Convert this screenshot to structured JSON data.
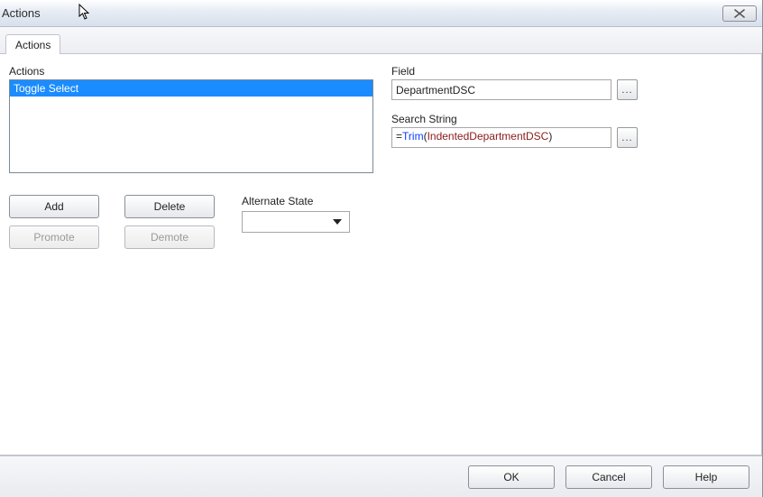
{
  "window": {
    "title": "Actions"
  },
  "tabs": [
    "Actions"
  ],
  "panel": {
    "actions_label": "Actions",
    "actions": [
      "Toggle Select"
    ],
    "add_label": "Add",
    "delete_label": "Delete",
    "promote_label": "Promote",
    "demote_label": "Demote",
    "alternate_state_label": "Alternate State",
    "alternate_state_value": "",
    "field_label": "Field",
    "field_value": "DepartmentDSC",
    "search_string_label": "Search String",
    "search_string_expr": {
      "eq": "=",
      "func": "Trim",
      "open": "(",
      "field": "IndentedDepartmentDSC",
      "close": ")"
    },
    "ellipsis": "..."
  },
  "buttons": {
    "ok": "OK",
    "cancel": "Cancel",
    "help": "Help"
  }
}
